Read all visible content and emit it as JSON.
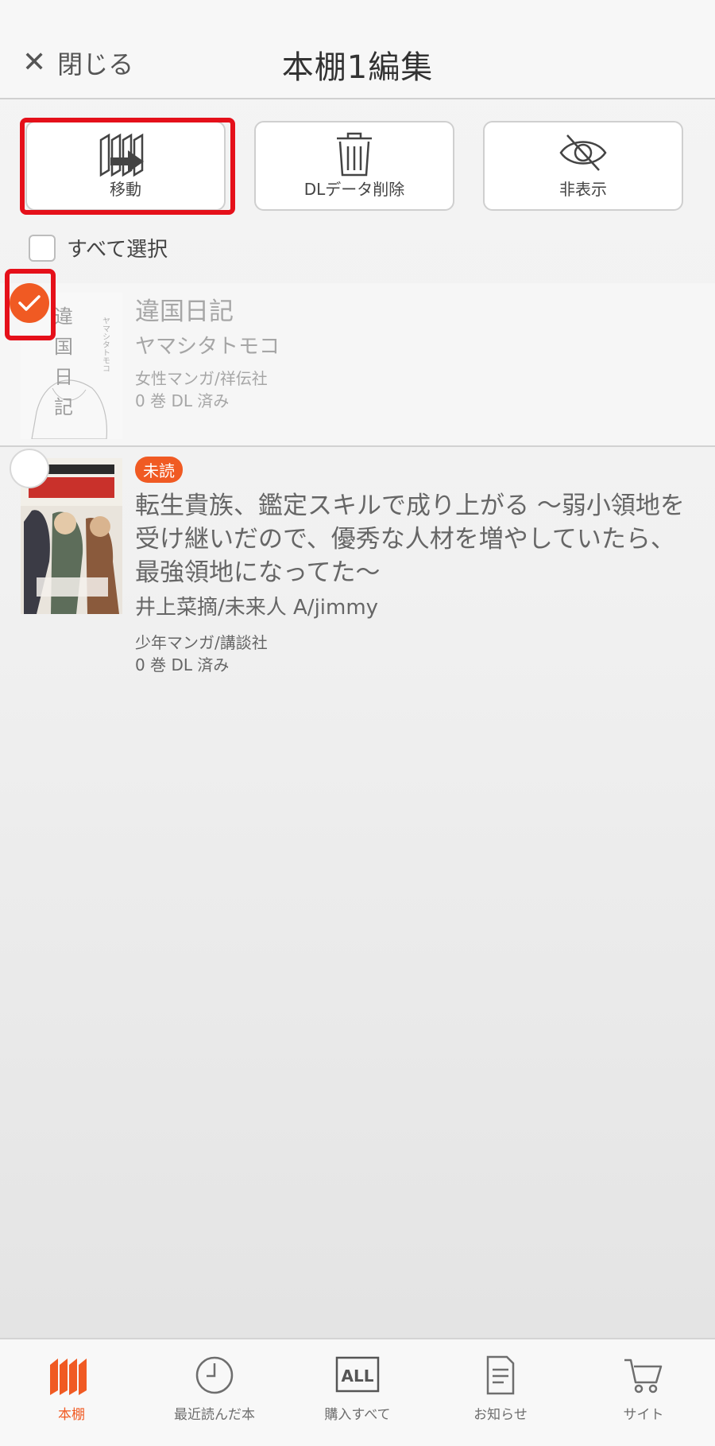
{
  "header": {
    "close_label": "閉じる",
    "title": "本棚1編集"
  },
  "actions": [
    {
      "label": "移動",
      "icon": "move-books-icon"
    },
    {
      "label": "DLデータ削除",
      "icon": "trash-icon"
    },
    {
      "label": "非表示",
      "icon": "eye-slash-icon"
    }
  ],
  "select_all": {
    "label": "すべて選択",
    "checked": false
  },
  "books": [
    {
      "selected": true,
      "title": "違国日記",
      "author": "ヤマシタトモコ",
      "category": "女性マンガ/祥伝社",
      "status": "0 巻 DL 済み",
      "cover_text": [
        "違",
        "国",
        "日",
        "記"
      ]
    },
    {
      "selected": false,
      "badge": "未読",
      "title": "転生貴族、鑑定スキルで成り上がる ～弱小領地を受け継いだので、優秀な人材を増やしていたら、最強領地になってた～",
      "author": "井上菜摘/未来人 A/jimmy",
      "category": "少年マンガ/講談社",
      "status": "0 巻 DL 済み"
    }
  ],
  "tabbar": [
    {
      "label": "本棚",
      "icon": "bookshelf-icon",
      "active": true
    },
    {
      "label": "最近読んだ本",
      "icon": "clock-icon",
      "active": false
    },
    {
      "label": "購入すべて",
      "icon": "all-icon",
      "active": false
    },
    {
      "label": "お知らせ",
      "icon": "document-icon",
      "active": false
    },
    {
      "label": "サイト",
      "icon": "cart-icon",
      "active": false
    }
  ],
  "colors": {
    "accent": "#f05a23",
    "highlight": "#e5101a"
  }
}
